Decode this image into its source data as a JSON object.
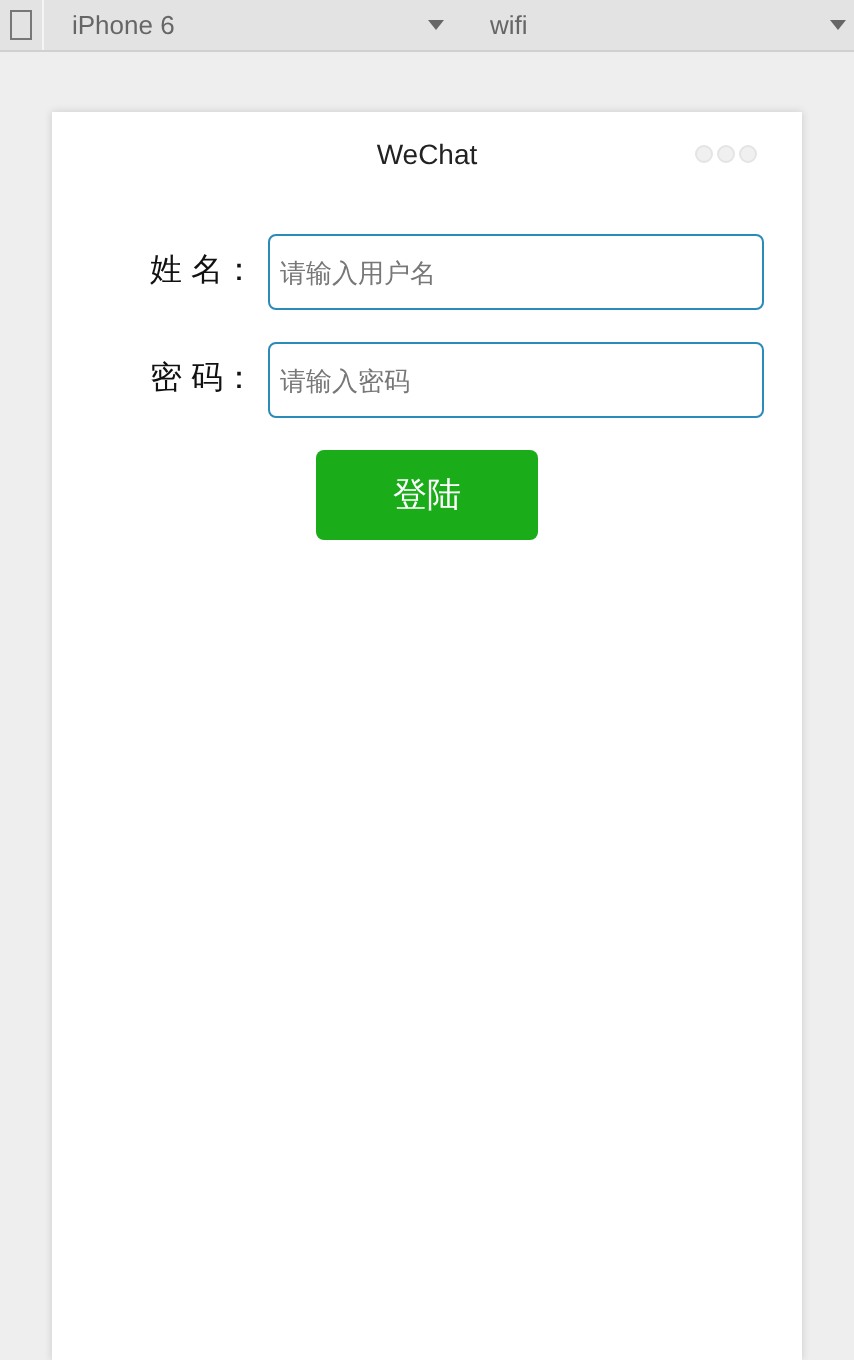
{
  "toolbar": {
    "device": "iPhone 6",
    "network": "wifi"
  },
  "page": {
    "title": "WeChat",
    "fields": [
      {
        "label": "姓 名：",
        "placeholder": "请输入用户名"
      },
      {
        "label": "密 码：",
        "placeholder": "请输入密码"
      }
    ],
    "button": "登陆"
  }
}
